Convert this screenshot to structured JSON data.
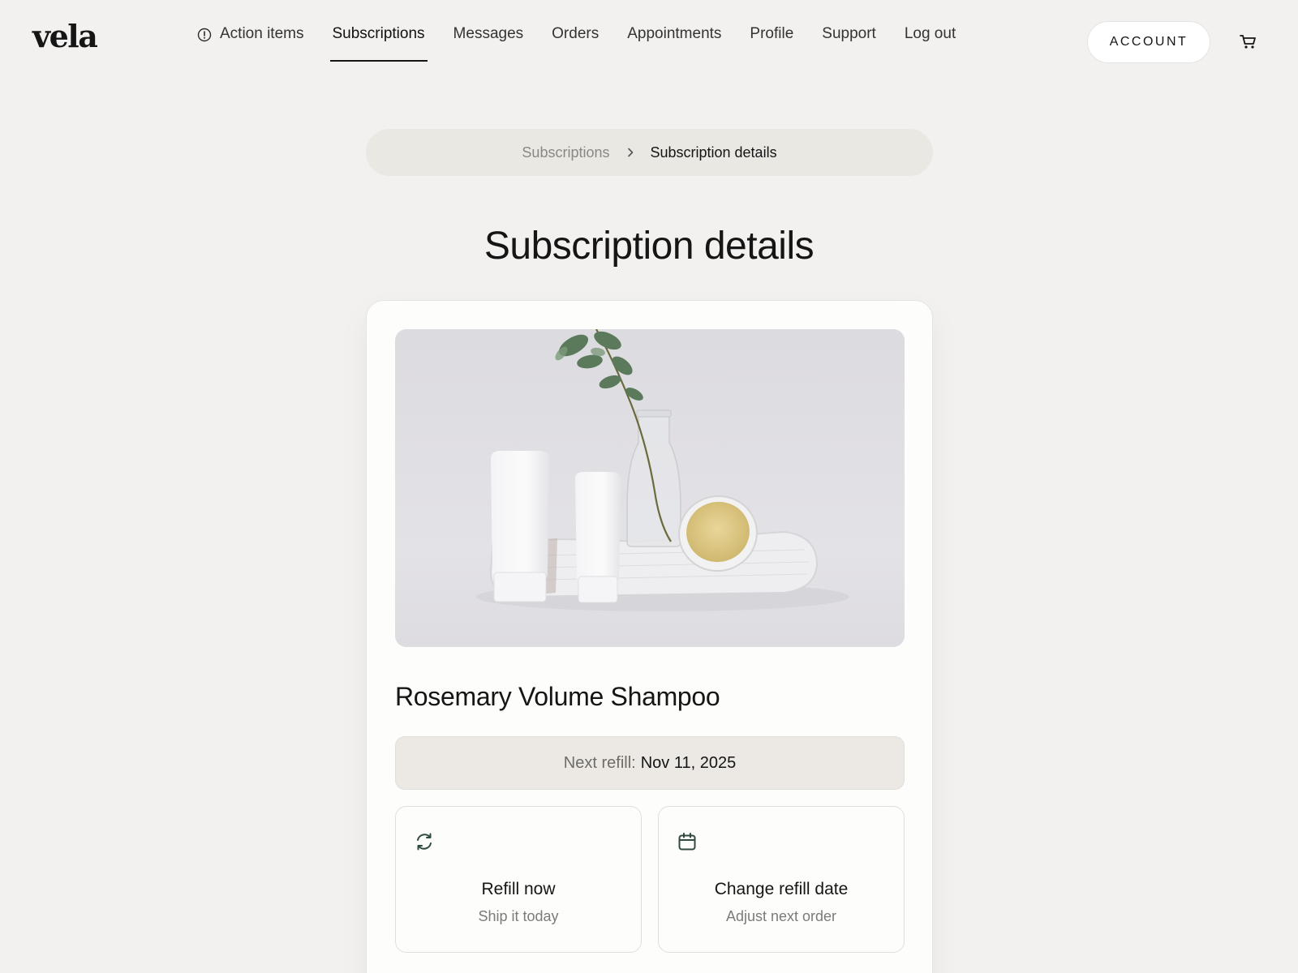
{
  "header": {
    "logo": "vela",
    "nav": [
      {
        "label": "Action items",
        "icon": "alert-circle-icon"
      },
      {
        "label": "Subscriptions",
        "active": true
      },
      {
        "label": "Messages"
      },
      {
        "label": "Orders"
      },
      {
        "label": "Appointments"
      },
      {
        "label": "Profile"
      },
      {
        "label": "Support"
      },
      {
        "label": "Log out"
      }
    ],
    "account_button": "ACCOUNT",
    "cart_icon": "cart-icon"
  },
  "breadcrumb": {
    "parent": "Subscriptions",
    "separator_icon": "chevron-right-icon",
    "current": "Subscription details"
  },
  "page_title": "Subscription details",
  "subscription": {
    "product_name": "Rosemary Volume Shampoo",
    "image": "product-photo",
    "next_refill_label": "Next refill:",
    "next_refill_date": "Nov 11, 2025"
  },
  "actions": [
    {
      "title": "Refill now",
      "subtitle": "Ship it today",
      "icon": "refresh-icon"
    },
    {
      "title": "Change refill date",
      "subtitle": "Adjust next order",
      "icon": "calendar-icon"
    }
  ],
  "colors": {
    "background": "#f2f1ef",
    "card": "#fdfdfc",
    "pill": "#eae8e3",
    "text": "#151515",
    "muted": "#7d7b77",
    "icon_accent": "#2f4a3f"
  }
}
